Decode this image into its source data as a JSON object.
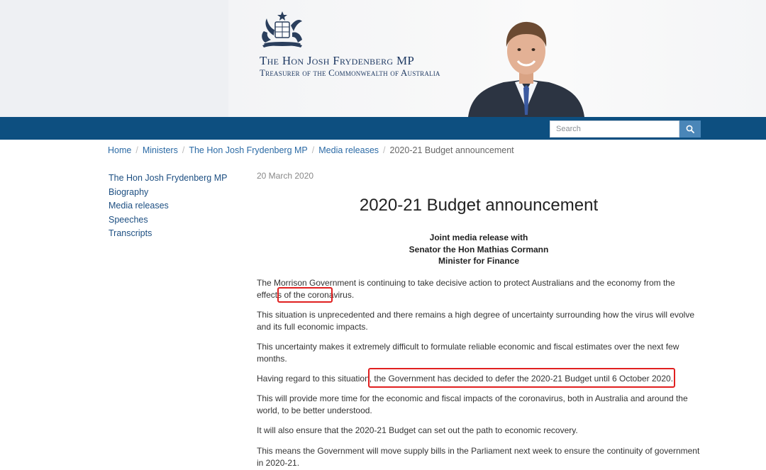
{
  "header": {
    "title": "The Hon Josh Frydenberg MP",
    "subtitle": "Treasurer of the Commonwealth of Australia"
  },
  "search": {
    "placeholder": "Search"
  },
  "breadcrumb": [
    "Home",
    "Ministers",
    "The Hon Josh Frydenberg MP",
    "Media releases",
    "2020-21 Budget announcement"
  ],
  "sidebar": {
    "items": [
      {
        "label": "The Hon Josh Frydenberg MP"
      },
      {
        "label": "Biography"
      },
      {
        "label": "Media releases"
      },
      {
        "label": "Speeches"
      },
      {
        "label": "Transcripts"
      }
    ]
  },
  "article": {
    "date": "20 March 2020",
    "title": "2020-21 Budget announcement",
    "joint_lines": [
      "Joint media release with",
      "Senator the Hon Mathias Cormann",
      "Minister for Finance"
    ],
    "p1_text": "The Morrison Government is continuing to take decisive action to protect Australians and the economy from the effects of the ",
    "p1_highlight": "coronavirus.",
    "p2": "This situation is unprecedented and there remains a high degree of uncertainty surrounding how the virus will evolve and its full economic impacts.",
    "p3": "This uncertainty makes it extremely difficult to formulate reliable economic and fiscal estimates over the next few months.",
    "p4_text": "Having regard to this situation, ",
    "p4_highlight": "the Government has decided to defer the 2020-21 Budget until 6 October 2020.",
    "p5": "This will provide more time for the economic and fiscal impacts of the coronavirus, both in Australia and around the world, to be better understood.",
    "p6": "It will also ensure that the 2020-21 Budget can set out the path to economic recovery.",
    "p7": "This means the Government will move supply bills in the Parliament next week to ensure the continuity of government in 2020-21."
  },
  "colors": {
    "navbar": "#0d4f80",
    "link": "#2b6aa5",
    "highlight": "#e02020"
  }
}
